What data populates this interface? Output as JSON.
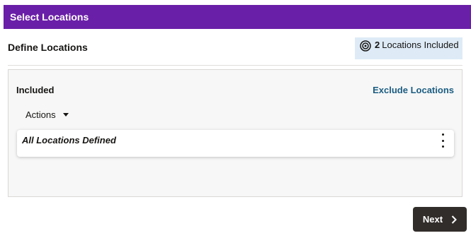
{
  "header": {
    "title": "Select Locations"
  },
  "section": {
    "title": "Define Locations",
    "badge": {
      "count": "2",
      "label": "Locations Included",
      "icon": "target-icon"
    }
  },
  "panel": {
    "included_label": "Included",
    "exclude_link": "Exclude Locations",
    "actions_label": "Actions",
    "items": [
      {
        "label": "All Locations Defined"
      }
    ]
  },
  "footer": {
    "next_label": "Next"
  },
  "colors": {
    "header_bg": "#6a1fa8",
    "badge_bg": "#deebf7",
    "link": "#1b5d82",
    "primary_button": "#312d2a"
  }
}
